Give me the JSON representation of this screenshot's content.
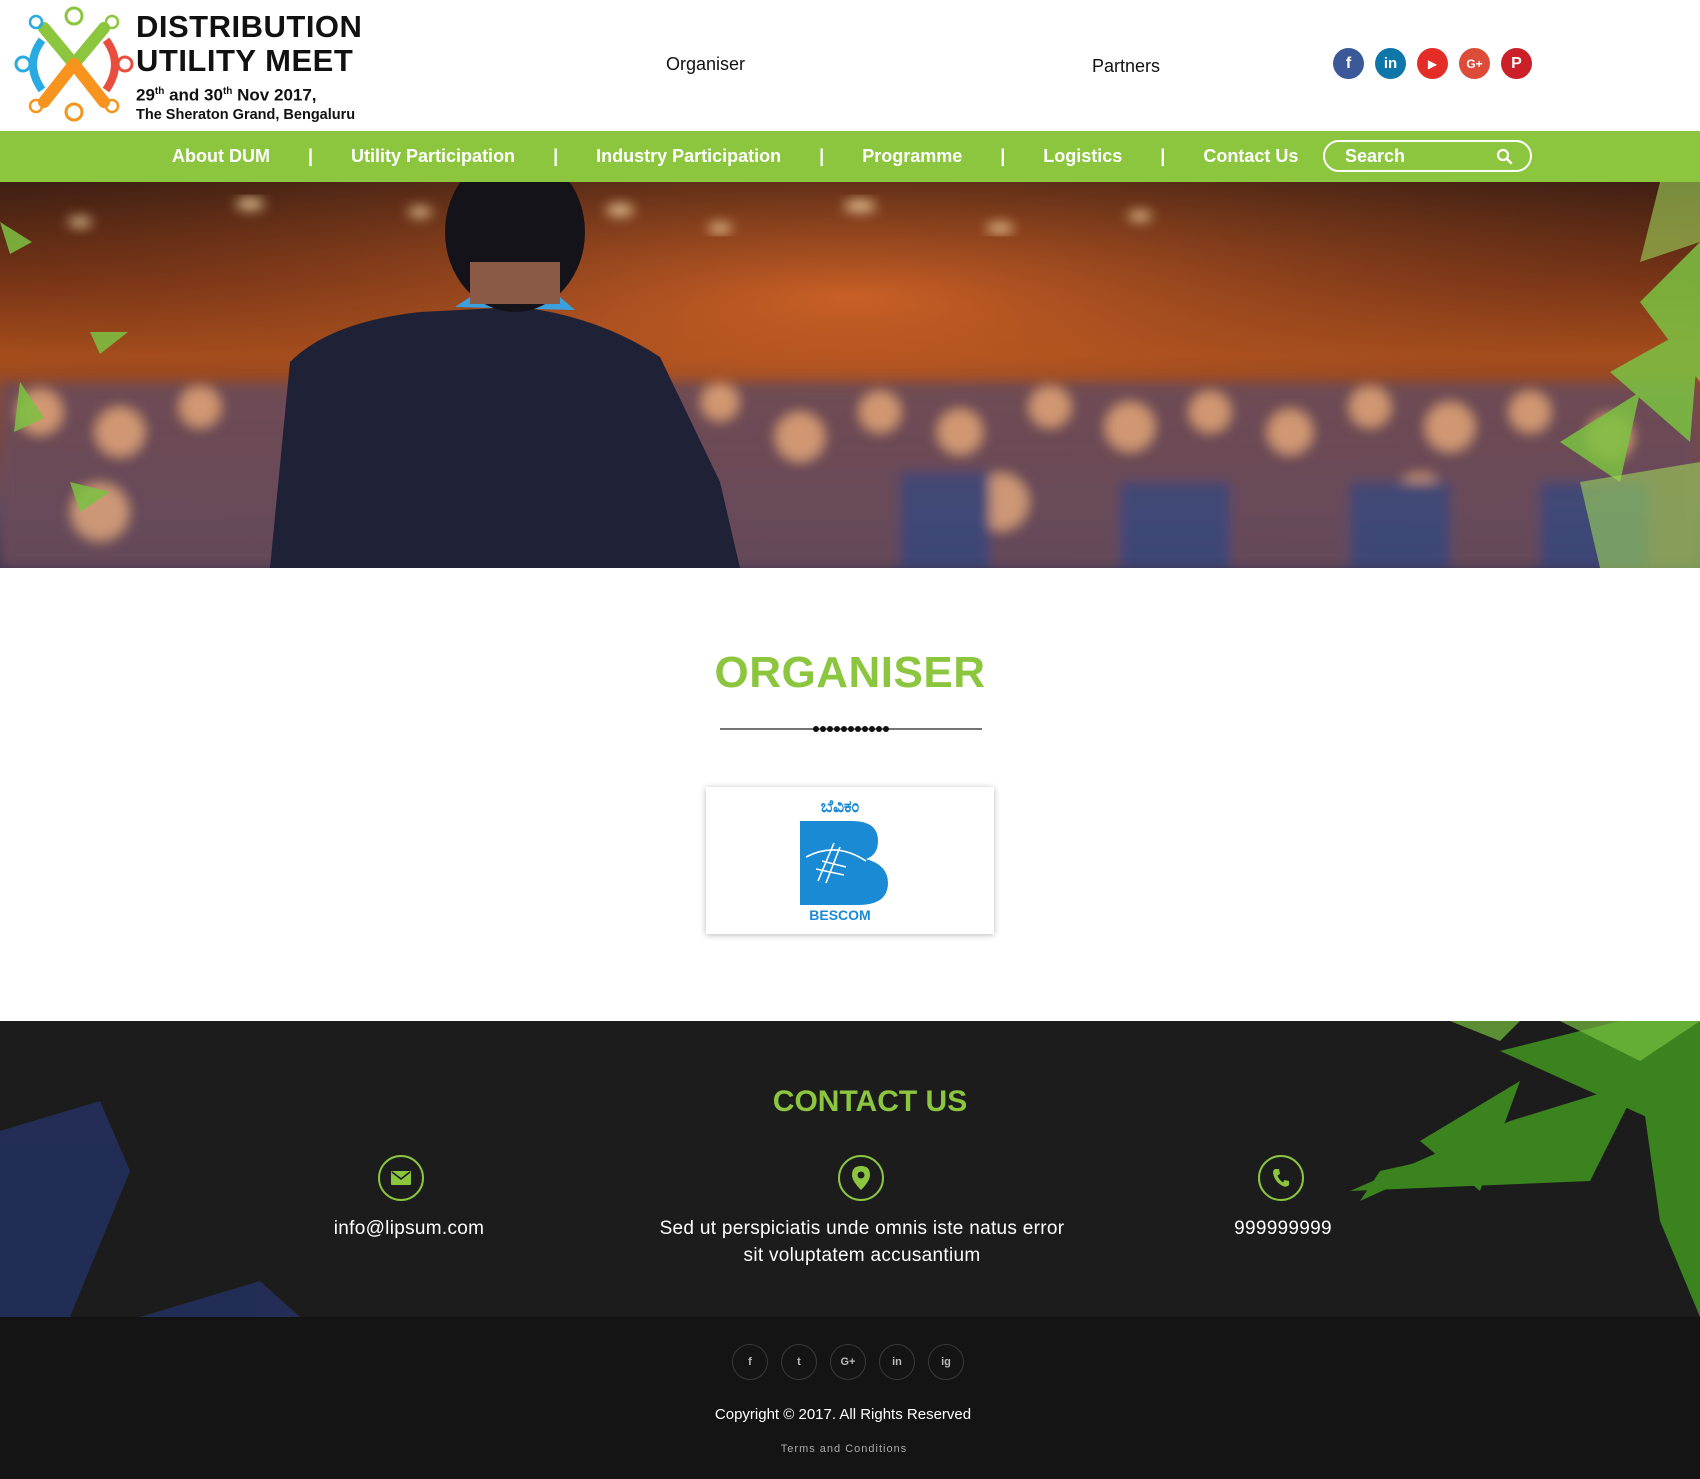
{
  "header": {
    "logo": {
      "title_line1": "DISTRIBUTION",
      "title_line2": "UTILITY MEET",
      "date_prefix": "29",
      "date_sup1": "th",
      "date_mid": " and 30",
      "date_sup2": "th",
      "date_suffix": " Nov 2017,",
      "venue": "The Sheraton Grand, Bengaluru"
    },
    "links": {
      "organiser": "Organiser",
      "partners": "Partners"
    },
    "social": [
      {
        "icon": "facebook-icon",
        "glyph": "f",
        "color": "#3b5998"
      },
      {
        "icon": "linkedin-icon",
        "glyph": "in",
        "color": "#0e76a8"
      },
      {
        "icon": "youtube-icon",
        "glyph": "▶",
        "color": "#e52d27"
      },
      {
        "icon": "google-plus-icon",
        "glyph": "G+",
        "color": "#dd4b39"
      },
      {
        "icon": "pinterest-icon",
        "glyph": "P",
        "color": "#cb2027"
      }
    ]
  },
  "nav": {
    "items": [
      "About DUM",
      "Utility Participation",
      "Industry Participation",
      "Programme",
      "Logistics",
      "Contact Us"
    ],
    "separator": "|",
    "search_placeholder": "Search"
  },
  "organiser": {
    "title": "ORGANISER",
    "logo_script": "ಬೆವಿಕಂ",
    "logo_name": "BESCOM"
  },
  "contact": {
    "title": "CONTACT US",
    "email": "info@lipsum.com",
    "address_line1": "Sed ut perspiciatis unde omnis iste natus error",
    "address_line2": "sit voluptatem accusantium",
    "phone": "999999999"
  },
  "footer": {
    "social": [
      "f",
      "t",
      "G+",
      "in",
      "ig"
    ],
    "copyright": "Copyright © 2017. All Rights Reserved",
    "terms": "Terms and Conditions"
  },
  "colors": {
    "brand_green": "#8cc63f",
    "footer_dark": "#1c1c1c",
    "footer_darker": "#141414"
  }
}
